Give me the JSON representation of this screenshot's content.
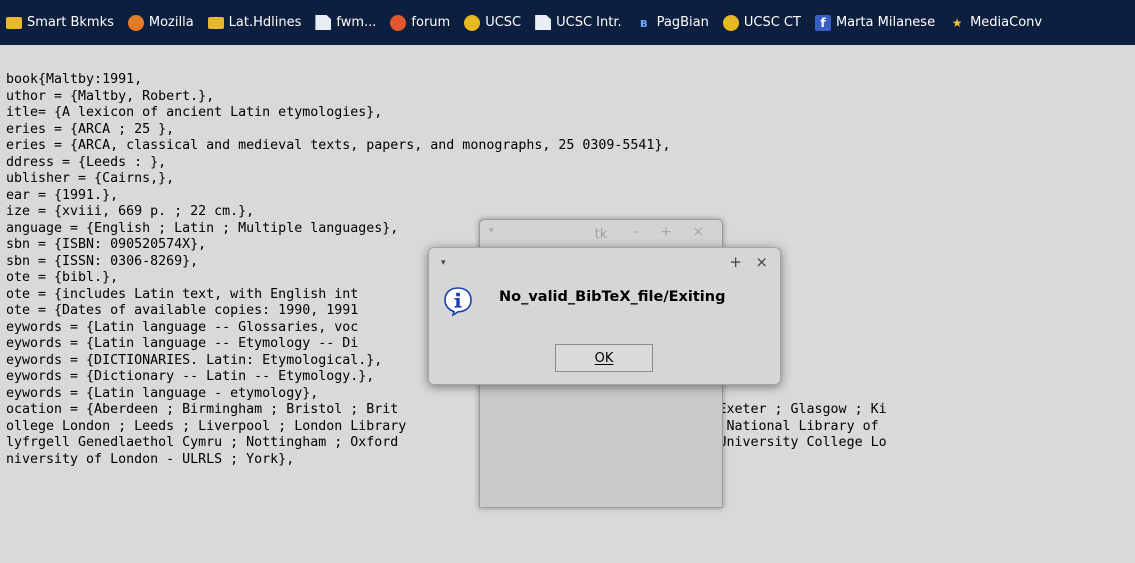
{
  "bookmarks": [
    {
      "label": "Smart Bkmks",
      "icon": "folder-icon"
    },
    {
      "label": "Mozilla",
      "icon": "mozilla-icon"
    },
    {
      "label": "Lat.Hdlines",
      "icon": "folder-icon"
    },
    {
      "label": "fwm...",
      "icon": "page-icon"
    },
    {
      "label": "forum",
      "icon": "forum-icon"
    },
    {
      "label": "UCSC",
      "icon": "globe-icon"
    },
    {
      "label": "UCSC Intr.",
      "icon": "page-icon"
    },
    {
      "label": "PagBian",
      "icon": "pagbian-icon"
    },
    {
      "label": "UCSC CT",
      "icon": "globe-icon"
    },
    {
      "label": "Marta Milanese",
      "icon": "facebook-icon"
    },
    {
      "label": "MediaConv",
      "icon": "star-icon"
    }
  ],
  "content_lines": [
    "book{Maltby:1991,",
    "uthor = {Maltby, Robert.},",
    "itle= {A lexicon of ancient Latin etymologies},",
    "eries = {ARCA ; 25 },",
    "eries = {ARCA, classical and medieval texts, papers, and monographs, 25 0309-5541},",
    "ddress = {Leeds : },",
    "ublisher = {Cairns,},",
    "ear = {1991.},",
    "ize = {xviii, 669 p. ; 22 cm.},",
    "anguage = {English ; Latin ; Multiple languages},",
    "sbn = {ISBN: 090520574X},",
    "sbn = {ISSN: 0306-8269},",
    "ote = {bibl.},",
    "ote = {includes Latin text, with English int",
    "ote = {Dates of available copies: 1990, 1991",
    "eywords = {Latin language -- Glossaries, voc",
    "eywords = {Latin language -- Etymology -- Di",
    "eywords = {DICTIONARIES. Latin: Etymological.},",
    "eywords = {Dictionary -- Latin -- Etymology.},",
    "eywords = {Latin language - etymology},",
    "ocation = {Aberdeen ; Birmingham ; Bristol ; Brit                   Durham ; Edinburgh ; Exeter ; Glasgow ; Ki",
    "ollege London ; Leeds ; Liverpool ; London Library                  Library of Scotland ; National Library of",
    "lyfrgell Genedlaethol Cymru ; Nottingham ; Oxford                   ollege Dublin ; UCL (University College Lo",
    "niversity of London - ULRLS ; York},"
  ],
  "tk_window": {
    "title": "tk",
    "menu_glyph": "▾",
    "controls": "– + ×"
  },
  "dialog": {
    "menu_glyph": "▾",
    "plus_glyph": "+",
    "close_glyph": "×",
    "icon": "info-icon",
    "message": "No_valid_BibTeX_file/Exiting",
    "ok_label": "OK"
  },
  "colors": {
    "bookmarks_bar": "#0d1f3f",
    "background": "#d9d9d9",
    "dialog_bg": "#d6d6d6",
    "info_icon_blue": "#1a3fb3"
  }
}
